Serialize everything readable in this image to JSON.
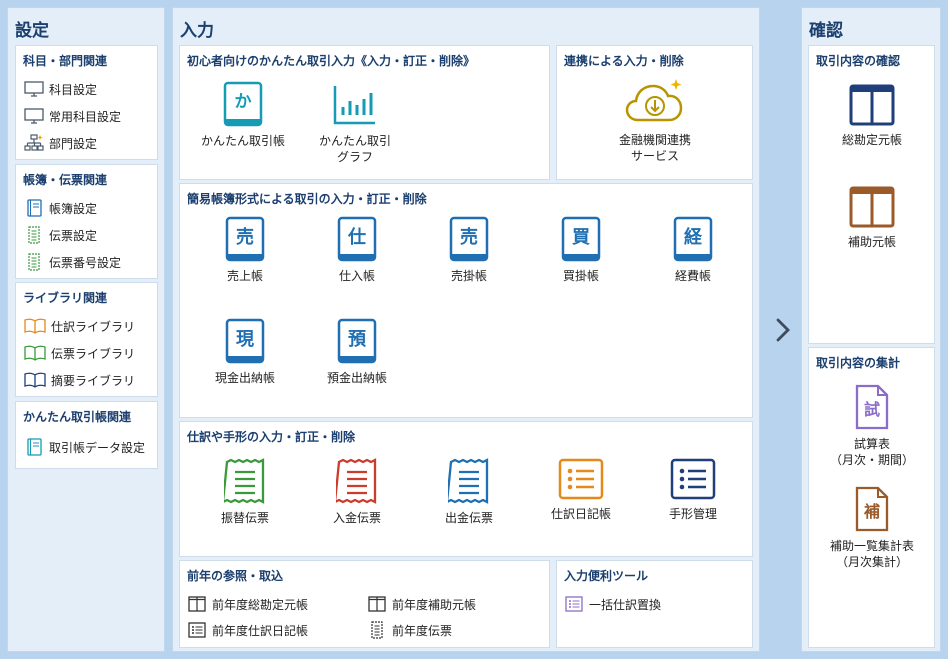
{
  "settings": {
    "title": "設定",
    "groups": [
      {
        "title": "科目・部門関連",
        "items": [
          {
            "label": "科目設定",
            "icon": "monitor-icon"
          },
          {
            "label": "常用科目設定",
            "icon": "monitor-icon"
          },
          {
            "label": "部門設定",
            "icon": "org-chart-icon"
          }
        ]
      },
      {
        "title": "帳簿・伝票関連",
        "items": [
          {
            "label": "帳簿設定",
            "icon": "book-icon"
          },
          {
            "label": "伝票設定",
            "icon": "voucher-icon"
          },
          {
            "label": "伝票番号設定",
            "icon": "voucher-icon"
          }
        ]
      },
      {
        "title": "ライブラリ関連",
        "items": [
          {
            "label": "仕訳ライブラリ",
            "icon": "open-book-icon"
          },
          {
            "label": "伝票ライブラリ",
            "icon": "open-book-icon"
          },
          {
            "label": "摘要ライブラリ",
            "icon": "open-book-icon"
          }
        ]
      },
      {
        "title": "かんたん取引帳関連",
        "items": [
          {
            "label": "取引帳データ設定",
            "icon": "book-icon"
          }
        ]
      }
    ]
  },
  "input": {
    "title": "入力",
    "beginner": {
      "title": "初心者向けのかんたん取引入力《入力・訂正・削除》",
      "tiles": [
        {
          "label": "かんたん取引帳",
          "glyph": "か"
        },
        {
          "label": "かんたん取引\nグラフ",
          "glyph": ""
        }
      ]
    },
    "linkage": {
      "title": "連携による入力・削除",
      "tiles": [
        {
          "label": "金融機関連携\nサービス",
          "glyph": ""
        }
      ]
    },
    "ledger": {
      "title": "簡易帳簿形式による取引の入力・訂正・削除",
      "tiles": [
        {
          "label": "売上帳",
          "glyph": "売"
        },
        {
          "label": "仕入帳",
          "glyph": "仕"
        },
        {
          "label": "売掛帳",
          "glyph": "売"
        },
        {
          "label": "買掛帳",
          "glyph": "買"
        },
        {
          "label": "経費帳",
          "glyph": "経"
        },
        {
          "label": "現金出納帳",
          "glyph": "現"
        },
        {
          "label": "預金出納帳",
          "glyph": "預"
        }
      ]
    },
    "journal": {
      "title": "仕訳や手形の入力・訂正・削除",
      "tiles": [
        {
          "label": "振替伝票"
        },
        {
          "label": "入金伝票"
        },
        {
          "label": "出金伝票"
        },
        {
          "label": "仕訳日記帳"
        },
        {
          "label": "手形管理"
        }
      ]
    },
    "prev_year": {
      "title": "前年の参照・取込",
      "items": [
        {
          "label": "前年度総勘定元帳"
        },
        {
          "label": "前年度補助元帳"
        },
        {
          "label": "前年度仕訳日記帳"
        },
        {
          "label": "前年度伝票"
        }
      ]
    },
    "tools": {
      "title": "入力便利ツール",
      "items": [
        {
          "label": "一括仕訳置換"
        }
      ]
    }
  },
  "confirm": {
    "title": "確認",
    "check": {
      "title": "取引内容の確認",
      "tiles": [
        {
          "label": "総勘定元帳"
        },
        {
          "label": "補助元帳"
        }
      ]
    },
    "summary": {
      "title": "取引内容の集計",
      "tiles": [
        {
          "label": "試算表\n（月次・期間）",
          "glyph": "試"
        },
        {
          "label": "補助一覧集計表\n（月次集計）",
          "glyph": "補"
        }
      ]
    }
  },
  "colors": {
    "accent": "#1f6fb2",
    "teal": "#169bb5",
    "green": "#3a9a3a",
    "red": "#cc3b2b",
    "orange": "#e58a1a",
    "navy": "#1f3f7a",
    "gold": "#c8a200",
    "purple": "#8b6cc8",
    "brown": "#9a5a2a"
  }
}
